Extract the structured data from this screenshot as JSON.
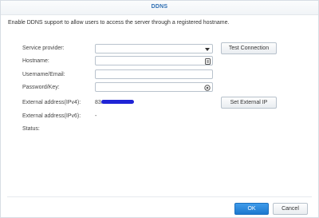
{
  "dialog": {
    "title": "DDNS",
    "description": "Enable DDNS support to allow users to access the server through a registered hostname."
  },
  "form": {
    "service_provider": {
      "label": "Service provider:",
      "value": ""
    },
    "hostname": {
      "label": "Hostname:",
      "value": ""
    },
    "username": {
      "label": "Username/Email:",
      "value": ""
    },
    "password": {
      "label": "Password/Key:",
      "value": ""
    },
    "external_ipv4": {
      "label": "External address(IPv4):",
      "value": "83."
    },
    "external_ipv6": {
      "label": "External address(IPv6):",
      "value": "-"
    },
    "status": {
      "label": "Status:",
      "value": ""
    }
  },
  "buttons": {
    "test_connection": "Test Connection",
    "set_external_ip": "Set External IP",
    "ok": "OK",
    "cancel": "Cancel"
  },
  "icons": {
    "dropdown": "chevron-down-icon",
    "hostname_field": "document-icon",
    "password_field": "eye-icon"
  },
  "colors": {
    "accent": "#2e6fb3",
    "primary_button": "#1c78cf",
    "redaction": "#1f24d6"
  }
}
